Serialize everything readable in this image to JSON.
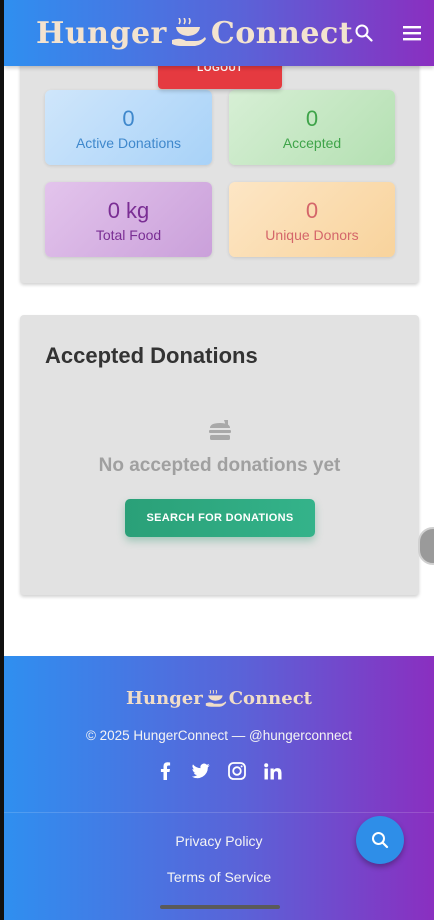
{
  "header": {
    "brand_left": "Hunger",
    "brand_right": "Connect",
    "icons": [
      "search-icon",
      "menu-icon"
    ]
  },
  "stats": {
    "logout_label": "LOGOUT",
    "tiles": [
      {
        "value": "0",
        "label": "Active Donations",
        "color": "#3f88cc"
      },
      {
        "value": "0",
        "label": "Accepted",
        "color": "#3fa44a"
      },
      {
        "value": "0 kg",
        "label": "Total Food",
        "color": "#7a2e94"
      },
      {
        "value": "0",
        "label": "Unique Donors",
        "color": "#d4666a"
      }
    ]
  },
  "accepted": {
    "title": "Accepted Donations",
    "empty_icon": "food-icon",
    "empty_text": "No accepted donations yet",
    "button_label": "SEARCH FOR DONATIONS"
  },
  "footer": {
    "brand_left": "Hunger",
    "brand_right": "Connect",
    "copyright": "© 2025 HungerConnect — @hungerconnect",
    "socials": [
      "facebook-icon",
      "twitter-icon",
      "instagram-icon",
      "linkedin-icon"
    ],
    "links": [
      "Privacy Policy",
      "Terms of Service"
    ],
    "fab_icon": "search-icon"
  },
  "colors": {
    "gradient_start": "#2f8ff0",
    "gradient_end": "#8a2fc0",
    "logout": "#e53a40",
    "search_button": "#2aa078",
    "fab": "#2e8ee8"
  }
}
